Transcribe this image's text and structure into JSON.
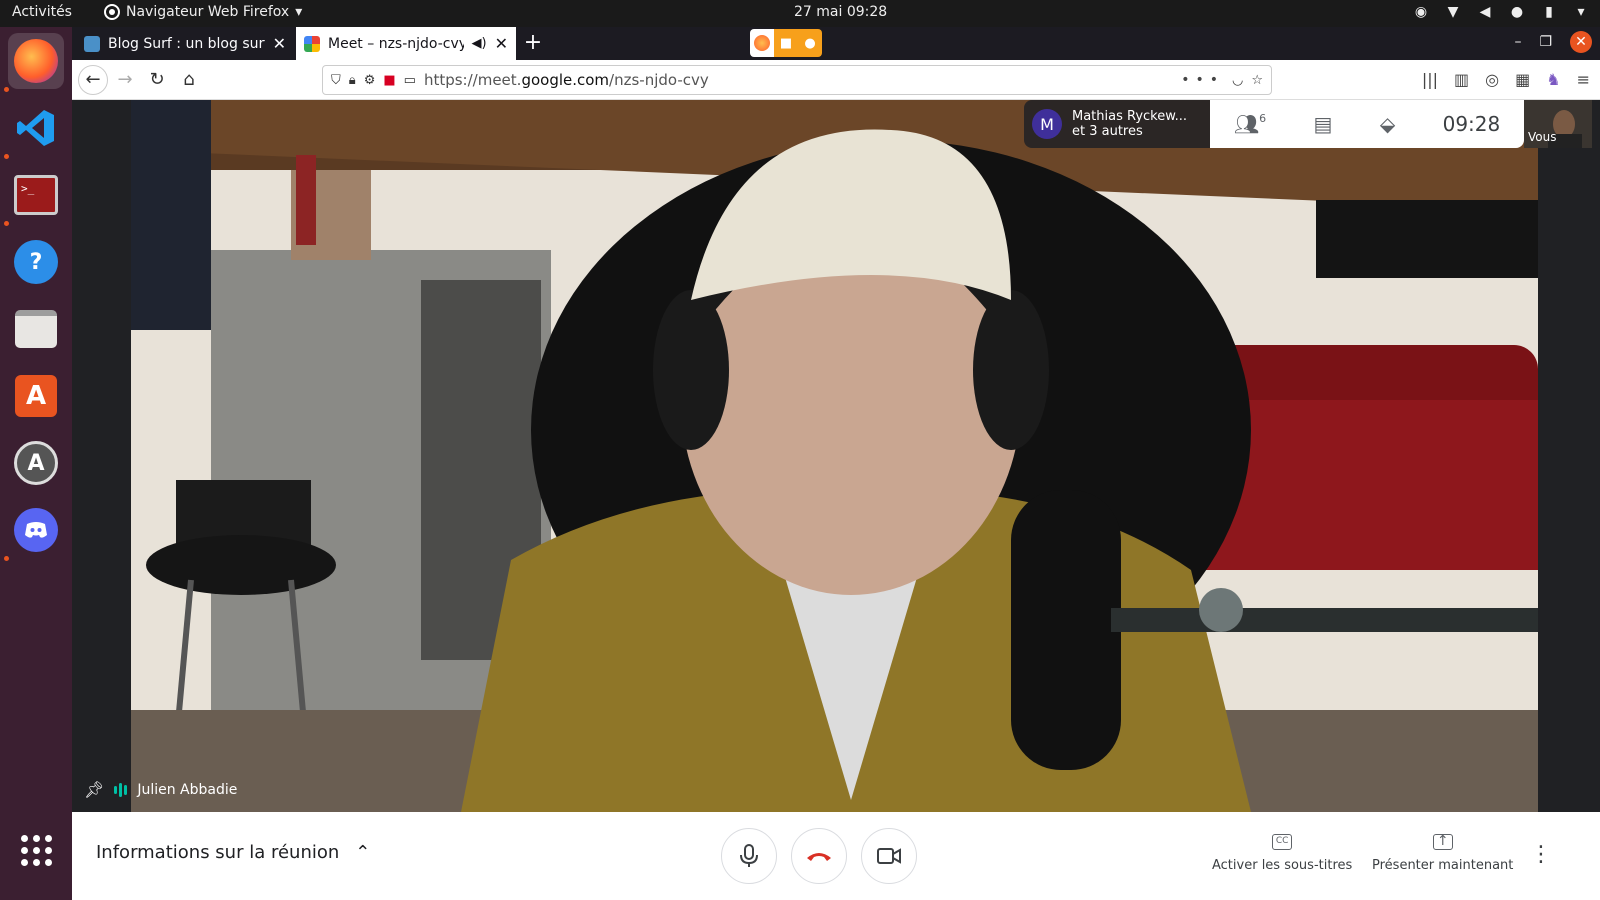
{
  "system": {
    "activities": "Activités",
    "app_name": "Navigateur Web Firefox",
    "clock": "27 mai  09:28"
  },
  "dock": {
    "items": [
      "firefox-icon",
      "vscode-icon",
      "terminal-icon",
      "help-icon",
      "files-icon",
      "software-icon",
      "updater-icon",
      "discord-icon",
      "app-grid-icon"
    ]
  },
  "browser": {
    "tabs": [
      {
        "title": "Blog Surf : un blog surf le",
        "active": false
      },
      {
        "title": "Meet – nzs-njdo-cvy",
        "active": true
      }
    ],
    "url_prefix": "https://meet.",
    "url_domain": "google.com",
    "url_path": "/nzs-njdo-cvy"
  },
  "meet": {
    "participant_name": "Julien Abbadie",
    "people_chip_initial": "M",
    "people_chip_line1": "Mathias Ryckew...",
    "people_chip_line2": "et 3 autres",
    "participants_count": "6",
    "time": "09:28",
    "self_label": "Vous",
    "meeting_info": "Informations sur la réunion",
    "captions_label": "Activer les sous-titres",
    "present_label": "Présenter maintenant",
    "captions_symbol": "CC",
    "present_symbol": "↑"
  },
  "colors": {
    "accent_orange": "#e95420",
    "hangup_red": "#d93025",
    "audio_teal": "#00bfa5",
    "avatar_purple": "#3f2f9a"
  }
}
